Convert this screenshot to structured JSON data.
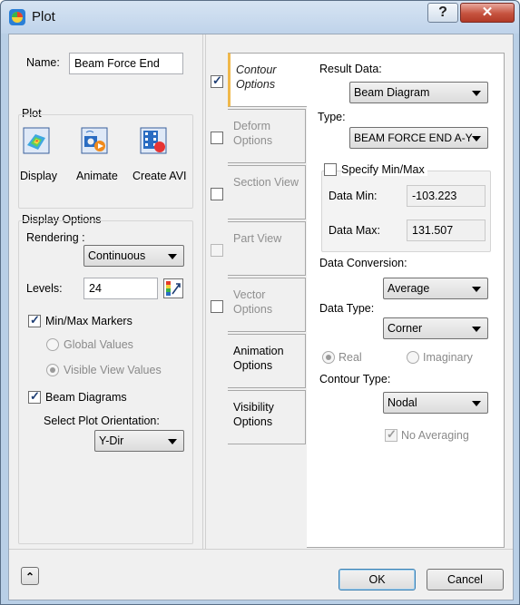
{
  "window": {
    "title": "Plot",
    "help_glyph": "?",
    "close_glyph": "✕"
  },
  "left": {
    "name_label": "Name:",
    "name_value": "Beam Force End",
    "plot_group": "Plot",
    "plot_buttons": [
      {
        "label": "Display",
        "icon": "display-icon"
      },
      {
        "label": "Animate",
        "icon": "animate-icon"
      },
      {
        "label": "Create AVI",
        "icon": "create-avi-icon"
      }
    ],
    "display_options": "Display Options",
    "rendering_label": "Rendering :",
    "rendering_value": "Continuous",
    "levels_label": "Levels:",
    "levels_value": "24",
    "minmax_markers": "Min/Max Markers",
    "global_values": "Global Values",
    "visible_view_values": "Visible View Values",
    "beam_diagrams": "Beam Diagrams",
    "orientation_label": "Select Plot Orientation:",
    "orientation_value": "Y-Dir"
  },
  "tabs": [
    {
      "label": "Contour Options",
      "checked": true
    },
    {
      "label": "Deform Options",
      "checked": false
    },
    {
      "label": "Section View",
      "checked": false
    },
    {
      "label": "Part View",
      "checked": false
    },
    {
      "label": "Vector Options",
      "checked": false
    },
    {
      "label": "Animation Options",
      "checked": null
    },
    {
      "label": "Visibility Options",
      "checked": null
    }
  ],
  "contour": {
    "result_data_label": "Result Data:",
    "result_data_value": "Beam Diagram",
    "type_label": "Type:",
    "type_value": "BEAM FORCE END A-Y",
    "specify_minmax": "Specify Min/Max",
    "data_min_label": "Data Min:",
    "data_min_value": "-103.223",
    "data_max_label": "Data Max:",
    "data_max_value": "131.507",
    "data_conversion_label": "Data Conversion:",
    "data_conversion_value": "Average",
    "data_type_label": "Data Type:",
    "data_type_value": "Corner",
    "real_label": "Real",
    "imaginary_label": "Imaginary",
    "contour_type_label": "Contour Type:",
    "contour_type_value": "Nodal",
    "no_averaging": "No Averaging"
  },
  "footer": {
    "collapse_glyph": "⌃",
    "ok": "OK",
    "cancel": "Cancel"
  },
  "colors": {
    "accent_tab": "#f0b84a",
    "title_bg": "#bfd3ea",
    "close_red": "#c6533f"
  }
}
